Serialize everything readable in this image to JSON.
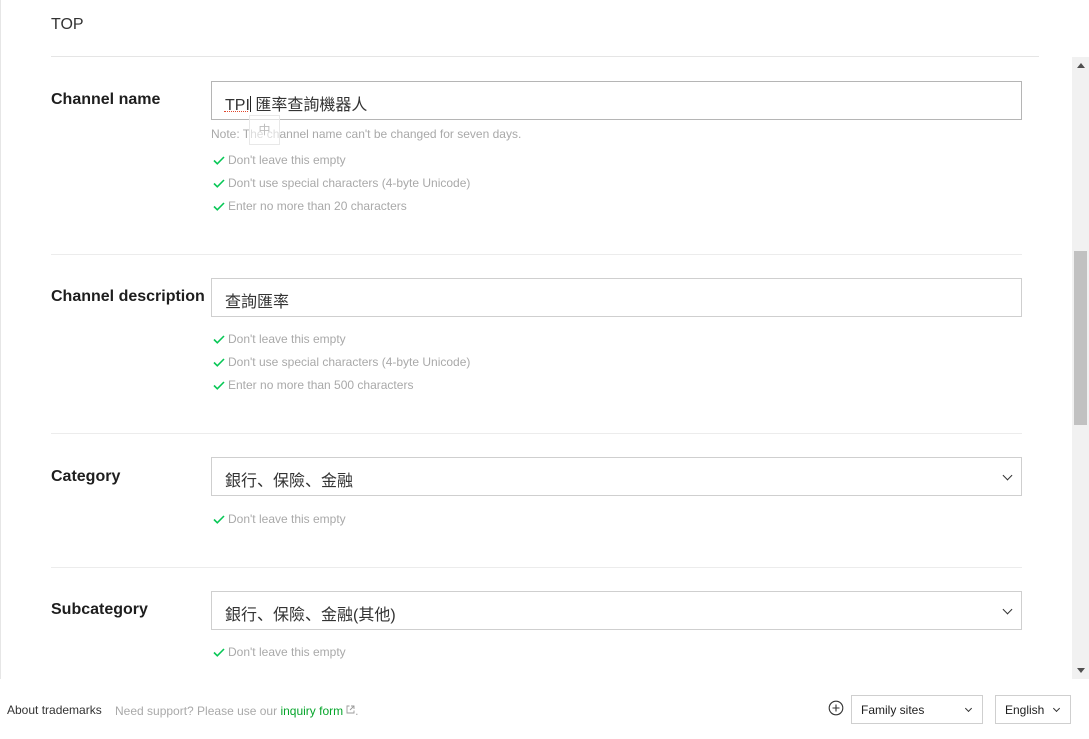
{
  "header": {
    "title": "TOP"
  },
  "channel_name": {
    "label": "Channel name",
    "value": "TPI 匯率查詢機器人",
    "value_before_caret": "TPI",
    "value_after_caret": " 匯率查詢機器人",
    "ime_mode": "中",
    "note": "Note: The channel name can't be changed for seven days.",
    "checks": [
      "Don't leave this empty",
      "Don't use special characters (4-byte Unicode)",
      "Enter no more than 20 characters"
    ]
  },
  "channel_description": {
    "label": "Channel description",
    "value": "查詢匯率",
    "checks": [
      "Don't leave this empty",
      "Don't use special characters (4-byte Unicode)",
      "Enter no more than 500 characters"
    ]
  },
  "category": {
    "label": "Category",
    "value": "銀行、保險、金融",
    "checks": [
      "Don't leave this empty"
    ]
  },
  "subcategory": {
    "label": "Subcategory",
    "value": "銀行、保險、金融(其他)",
    "checks": [
      "Don't leave this empty"
    ]
  },
  "footer": {
    "trademarks": "About trademarks",
    "support_prefix": "Need support? Please use our",
    "inquiry_link": "inquiry form",
    "support_suffix": ".",
    "family_sites": "Family sites",
    "language": "English"
  },
  "colors": {
    "check_green": "#06c755",
    "link_green": "#06a52b"
  }
}
